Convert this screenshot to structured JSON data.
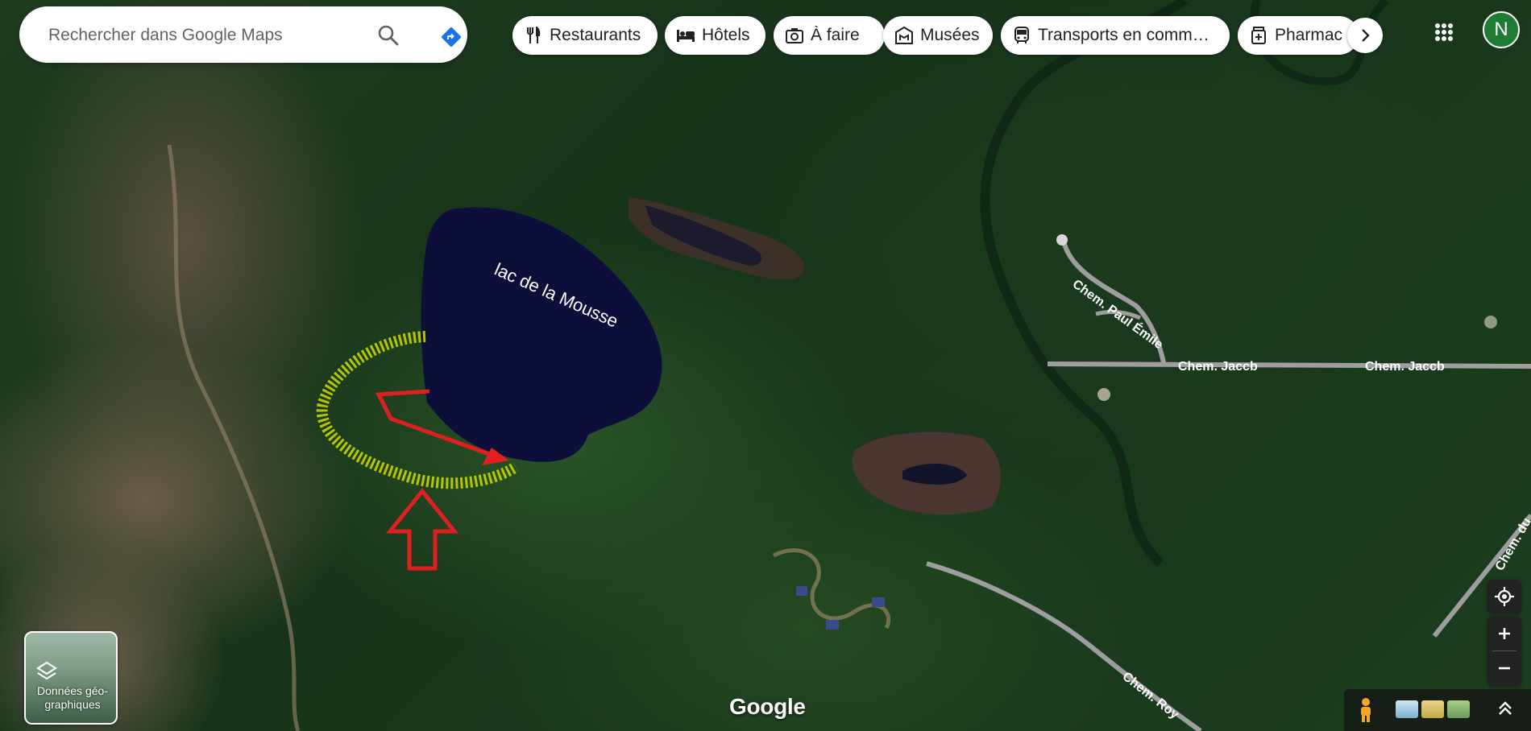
{
  "search": {
    "placeholder": "Rechercher dans Google Maps"
  },
  "chips": [
    {
      "label": "Restaurants",
      "icon": "fork-knife-icon"
    },
    {
      "label": "Hôtels",
      "icon": "bed-icon"
    },
    {
      "label": "À faire",
      "icon": "camera-icon"
    },
    {
      "label": "Musées",
      "icon": "museum-icon"
    },
    {
      "label": "Transports en comm…",
      "icon": "bus-icon"
    },
    {
      "label": "Pharmac",
      "icon": "pharmacy-icon"
    }
  ],
  "account": {
    "initial": "N",
    "color": "#1e7b34"
  },
  "map_labels": {
    "lake": "lac de la Mousse",
    "road_paul_emile": "Chem. Paul Émile",
    "road_jacob_1": "Chem. Jaccb",
    "road_jacob_2": "Chem. Jaccb",
    "road_roy": "Chem. Roy",
    "road_edge": "Chem. du"
  },
  "layers": {
    "label": "Données géo-graphiques"
  },
  "brand": {
    "logo": "Google"
  },
  "colors": {
    "annotation_arrow": "#e02020",
    "annotation_highlight": "#c8d400",
    "lake": "#0d0f3a"
  }
}
